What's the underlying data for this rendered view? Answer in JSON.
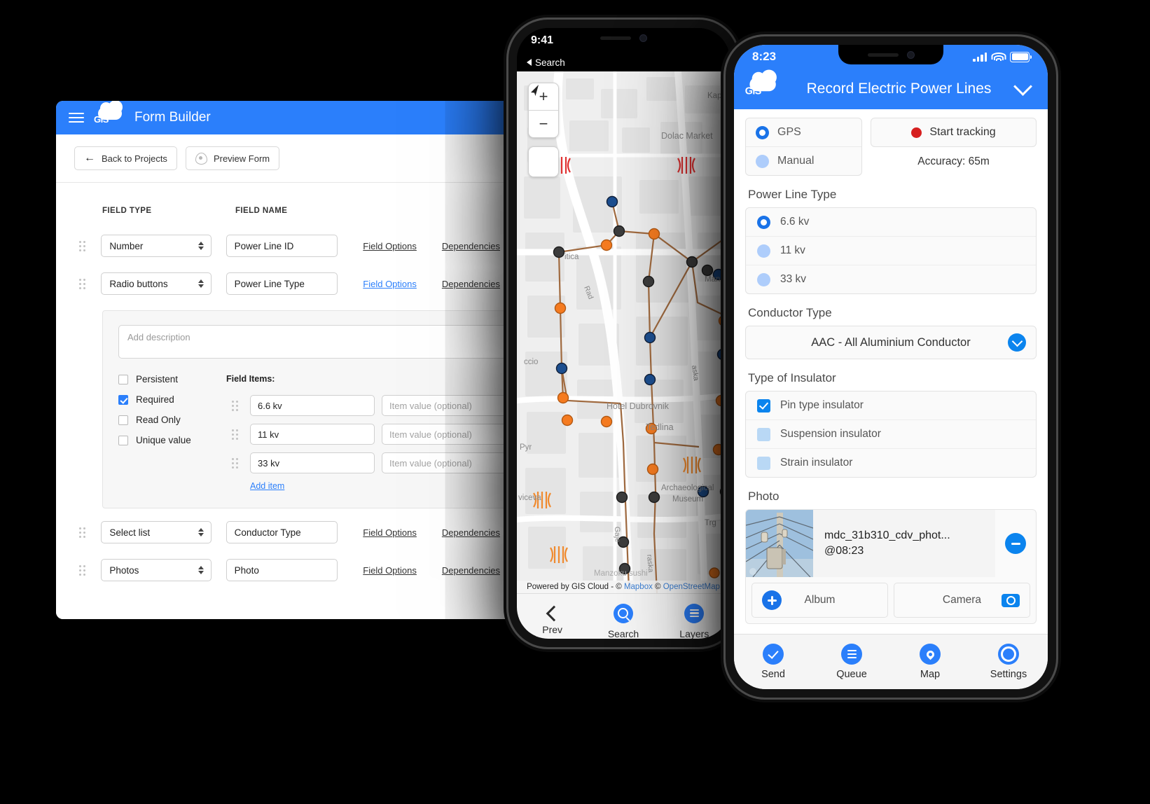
{
  "form_builder": {
    "title": "Form Builder",
    "logo_text": "GIS",
    "menu_icon": "hamburger-icon",
    "toolbar": {
      "back_label": "Back to Projects",
      "preview_label": "Preview Form"
    },
    "columns": {
      "field_type": "FIELD TYPE",
      "field_name": "FIELD NAME"
    },
    "links": {
      "field_options": "Field Options",
      "dependencies": "Dependencies"
    },
    "rows": [
      {
        "type": "Number",
        "name": "Power Line ID"
      },
      {
        "type": "Radio buttons",
        "name": "Power Line Type"
      },
      {
        "type": "Select list",
        "name": "Conductor Type"
      },
      {
        "type": "Photos",
        "name": "Photo"
      }
    ],
    "options_panel": {
      "description_placeholder": "Add description",
      "checkboxes": [
        {
          "label": "Persistent",
          "checked": false
        },
        {
          "label": "Required",
          "checked": true
        },
        {
          "label": "Read Only",
          "checked": false
        },
        {
          "label": "Unique value",
          "checked": false
        }
      ],
      "field_items_label": "Field Items:",
      "items": [
        {
          "name": "6.6 kv",
          "value_placeholder": "Item value (optional)"
        },
        {
          "name": "11 kv",
          "value_placeholder": "Item value (optional)"
        },
        {
          "name": "33 kv",
          "value_placeholder": "Item value (optional)"
        }
      ],
      "add_item_label": "Add item"
    }
  },
  "map_phone": {
    "status_time": "9:41",
    "back_label": "Search",
    "zoom_in": "+",
    "zoom_out": "−",
    "locate_icon": "navigate-arrow-icon",
    "attribution": {
      "prefix": "Powered by GIS Cloud - © ",
      "mapbox": "Mapbox",
      "mid": " © ",
      "osm": "OpenStreetMap"
    },
    "map_labels": [
      "Dolac Market",
      "Hotel Dubrovnik",
      "Tedlina",
      "Archaeological Museum",
      "Manzoku sushi",
      "Kap",
      "Radi",
      "Mand",
      "Trg",
      "Pyr",
      "ccio",
      "viceva",
      "Gaje",
      "itica",
      "raska",
      "aska"
    ],
    "nav": [
      {
        "label": "Prev",
        "icon": "chevron-left-icon"
      },
      {
        "label": "Search",
        "icon": "search-icon"
      },
      {
        "label": "Layers",
        "icon": "layers-icon"
      }
    ]
  },
  "record_phone": {
    "status_time": "8:23",
    "status_icons": [
      "signal-icon",
      "wifi-icon",
      "battery-icon"
    ],
    "logo_text": "GIS",
    "title": "Record Electric Power Lines",
    "collapse_icon": "chevron-down-icon",
    "location_modes": [
      {
        "label": "GPS",
        "selected": true
      },
      {
        "label": "Manual",
        "selected": false
      }
    ],
    "tracking_button": "Start tracking",
    "accuracy": "Accuracy: 65m",
    "power_line_type": {
      "label": "Power Line Type",
      "options": [
        {
          "label": "6.6 kv",
          "selected": true
        },
        {
          "label": "11 kv",
          "selected": false
        },
        {
          "label": "33 kv",
          "selected": false
        }
      ]
    },
    "conductor_type": {
      "label": "Conductor Type",
      "value": "AAC - All Aluminium Conductor"
    },
    "insulator_type": {
      "label": "Type of Insulator",
      "options": [
        {
          "label": "Pin type insulator",
          "checked": true
        },
        {
          "label": "Suspension insulator",
          "checked": false
        },
        {
          "label": "Strain insulator",
          "checked": false
        }
      ]
    },
    "photo": {
      "label": "Photo",
      "file_name": "mdc_31b310_cdv_phot...",
      "timestamp": "@08:23",
      "remove_icon": "minus-circle-icon",
      "album_button": "Album",
      "camera_button": "Camera"
    },
    "nav": [
      {
        "label": "Send",
        "icon": "send-check-icon"
      },
      {
        "label": "Queue",
        "icon": "queue-list-icon"
      },
      {
        "label": "Map",
        "icon": "map-pin-icon"
      },
      {
        "label": "Settings",
        "icon": "gear-icon"
      }
    ]
  },
  "colors": {
    "brand_blue": "#2b7ffb",
    "accent_blue": "#0b84ee",
    "marker_orange": "#f57b20",
    "marker_dark": "#3c3c3c",
    "marker_blue": "#1c4e8f",
    "record_red": "#d61f1f",
    "line_brown": "#a06a3f"
  }
}
